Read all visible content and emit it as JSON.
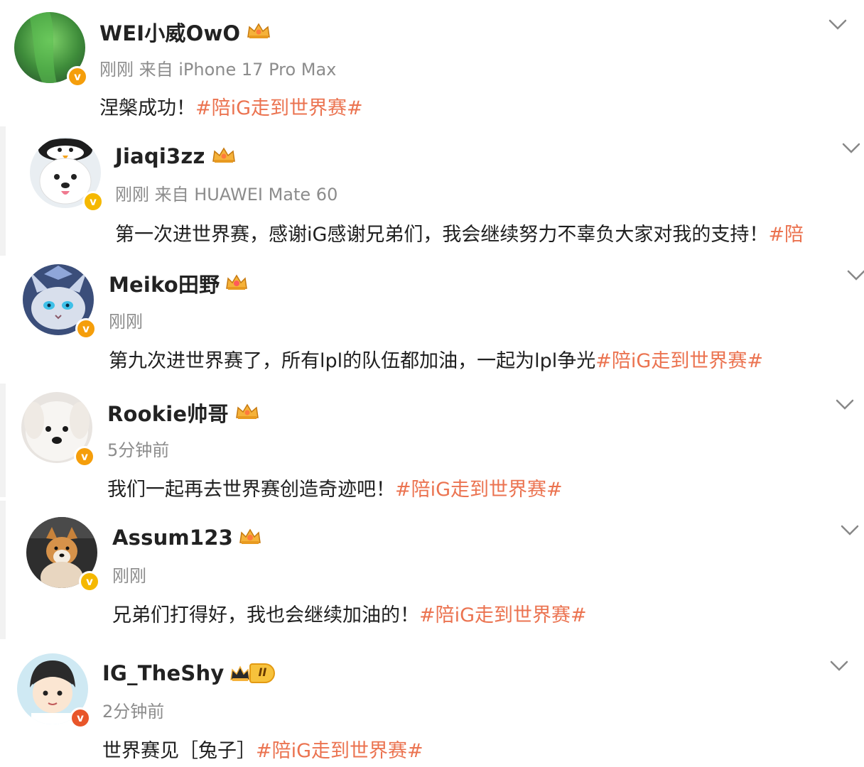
{
  "posts": [
    {
      "name": "WEI小威OwO",
      "meta": "刚刚 来自 iPhone 17 Pro Max",
      "text": "涅槃成功！",
      "tag": "#陪iG走到世界赛#"
    },
    {
      "name": "Jiaqi3zz",
      "meta": "刚刚 来自 HUAWEI Mate 60",
      "text": "第一次进世界赛，感谢iG感谢兄弟们，我会继续努力不辜负大家对我的支持！",
      "tag": "#陪"
    },
    {
      "name": "Meiko田野",
      "meta": "刚刚",
      "text": "第九次进世界赛了，所有lpl的队伍都加油，一起为lpl争光",
      "tag": "#陪iG走到世界赛#"
    },
    {
      "name": "Rookie帅哥",
      "meta": "5分钟前",
      "text": "我们一起再去世界赛创造奇迹吧！",
      "tag": "#陪iG走到世界赛#"
    },
    {
      "name": "Assum123",
      "meta": "刚刚",
      "text": "兄弟们打得好，我也会继续加油的！",
      "tag": "#陪iG走到世界赛#"
    },
    {
      "name": "IG_TheShy",
      "meta": "2分钟前",
      "text": "世界赛见［兔子］",
      "tag": "#陪iG走到世界赛#"
    }
  ],
  "verified_badge_glyph": "v",
  "vip_level_label": "II",
  "icons": {
    "verified": "verified-badge-icon",
    "crown": "crown-member-icon",
    "chevron": "chevron-down-icon"
  },
  "colors": {
    "tag": "#eb7350",
    "badge_orange": "#f59e0b",
    "badge_red": "#e8562a",
    "meta_gray": "#8c8c8c"
  }
}
